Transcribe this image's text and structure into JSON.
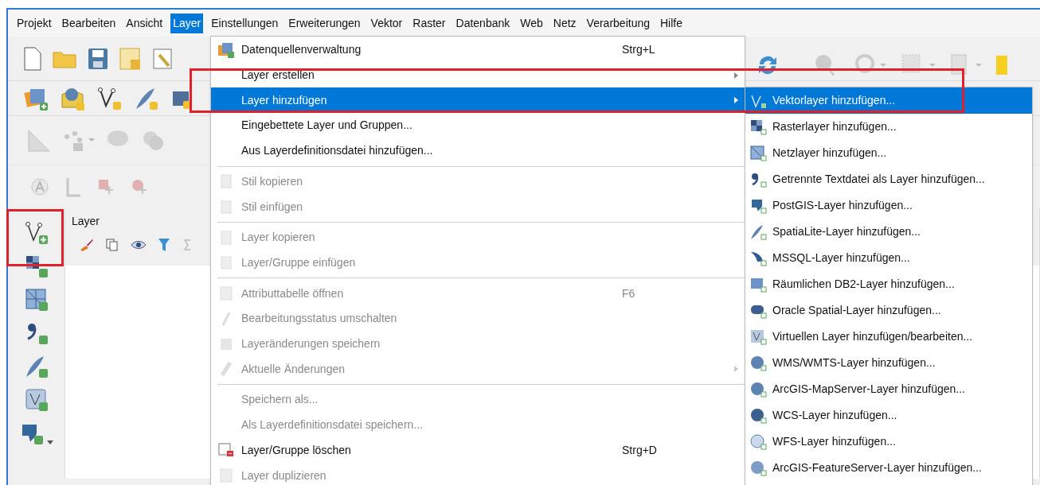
{
  "menubar": [
    {
      "label": "Projekt",
      "selected": false
    },
    {
      "label": "Bearbeiten",
      "selected": false
    },
    {
      "label": "Ansicht",
      "selected": false
    },
    {
      "label": "Layer",
      "selected": true
    },
    {
      "label": "Einstellungen",
      "selected": false
    },
    {
      "label": "Erweiterungen",
      "selected": false
    },
    {
      "label": "Vektor",
      "selected": false
    },
    {
      "label": "Raster",
      "selected": false
    },
    {
      "label": "Datenbank",
      "selected": false
    },
    {
      "label": "Web",
      "selected": false
    },
    {
      "label": "Netz",
      "selected": false
    },
    {
      "label": "Verarbeitung",
      "selected": false
    },
    {
      "label": "Hilfe",
      "selected": false
    }
  ],
  "layers_panel": {
    "title": "Layer"
  },
  "layer_menu": [
    {
      "kind": "item",
      "label": "Datenquellenverwaltung",
      "shortcut": "Strg+L",
      "disabled": false,
      "submenu": false,
      "selected": false
    },
    {
      "kind": "item",
      "label": "Layer erstellen",
      "disabled": false,
      "submenu": true,
      "selected": false
    },
    {
      "kind": "item",
      "label": "Layer hinzufügen",
      "disabled": false,
      "submenu": true,
      "selected": true
    },
    {
      "kind": "item",
      "label": "Eingebettete Layer und Gruppen...",
      "disabled": false,
      "submenu": false,
      "selected": false
    },
    {
      "kind": "item",
      "label": "Aus Layerdefinitionsdatei hinzufügen...",
      "disabled": false,
      "submenu": false,
      "selected": false
    },
    {
      "kind": "separator"
    },
    {
      "kind": "item",
      "label": "Stil kopieren",
      "disabled": true,
      "submenu": false,
      "selected": false
    },
    {
      "kind": "item",
      "label": "Stil einfügen",
      "disabled": true,
      "submenu": false,
      "selected": false
    },
    {
      "kind": "separator"
    },
    {
      "kind": "item",
      "label": "Layer kopieren",
      "disabled": true,
      "submenu": false,
      "selected": false
    },
    {
      "kind": "item",
      "label": "Layer/Gruppe einfügen",
      "disabled": true,
      "submenu": false,
      "selected": false
    },
    {
      "kind": "separator"
    },
    {
      "kind": "item",
      "label": "Attributtabelle öffnen",
      "shortcut": "F6",
      "disabled": true,
      "submenu": false,
      "selected": false
    },
    {
      "kind": "item",
      "label": "Bearbeitungsstatus umschalten",
      "disabled": true,
      "submenu": false,
      "selected": false
    },
    {
      "kind": "item",
      "label": "Layeränderungen speichern",
      "disabled": true,
      "submenu": false,
      "selected": false
    },
    {
      "kind": "item",
      "label": "Aktuelle Änderungen",
      "disabled": true,
      "submenu": true,
      "selected": false
    },
    {
      "kind": "separator"
    },
    {
      "kind": "item",
      "label": "Speichern als...",
      "disabled": true,
      "submenu": false,
      "selected": false
    },
    {
      "kind": "item",
      "label": "Als Layerdefinitionsdatei speichern...",
      "disabled": true,
      "submenu": false,
      "selected": false
    },
    {
      "kind": "item",
      "label": "Layer/Gruppe löschen",
      "shortcut": "Strg+D",
      "disabled": false,
      "submenu": false,
      "selected": false
    },
    {
      "kind": "item",
      "label": "Layer duplizieren",
      "disabled": true,
      "submenu": false,
      "selected": false
    }
  ],
  "add_layer_submenu": [
    {
      "label": "Vektorlayer hinzufügen...",
      "selected": true
    },
    {
      "label": "Rasterlayer hinzufügen...",
      "selected": false
    },
    {
      "label": "Netzlayer hinzufügen...",
      "selected": false
    },
    {
      "label": "Getrennte Textdatei als Layer hinzufügen...",
      "selected": false
    },
    {
      "label": "PostGIS-Layer hinzufügen...",
      "selected": false
    },
    {
      "label": "SpatiaLite-Layer hinzufügen...",
      "selected": false
    },
    {
      "label": "MSSQL-Layer hinzufügen...",
      "selected": false
    },
    {
      "label": "Räumlichen DB2-Layer hinzufügen...",
      "selected": false
    },
    {
      "label": "Oracle Spatial-Layer hinzufügen...",
      "selected": false
    },
    {
      "label": "Virtuellen Layer hinzufügen/bearbeiten...",
      "selected": false
    },
    {
      "label": "WMS/WMTS-Layer hinzufügen...",
      "selected": false
    },
    {
      "label": "ArcGIS-MapServer-Layer hinzufügen...",
      "selected": false
    },
    {
      "label": "WCS-Layer hinzufügen...",
      "selected": false
    },
    {
      "label": "WFS-Layer hinzufügen...",
      "selected": false
    },
    {
      "label": "ArcGIS-FeatureServer-Layer hinzufügen...",
      "selected": false
    }
  ]
}
